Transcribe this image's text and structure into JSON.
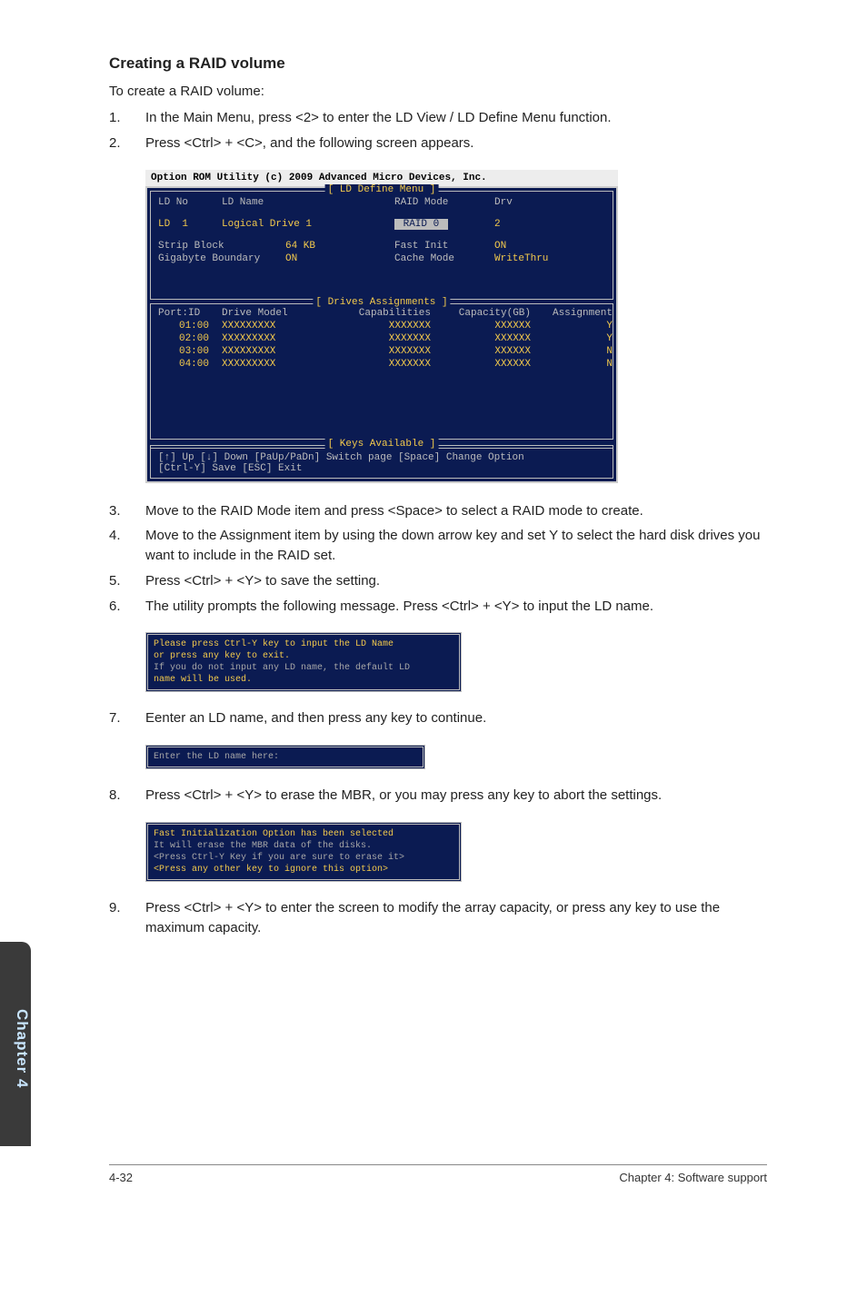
{
  "title": "Creating a RAID volume",
  "intro": "To create a RAID volume:",
  "steps1": [
    {
      "n": "1.",
      "t": "In the Main Menu, press <2> to enter the LD View / LD Define Menu function."
    },
    {
      "n": "2.",
      "t": "Press <Ctrl> + <C>, and the following screen appears."
    }
  ],
  "rom": {
    "header": "Option ROM Utility (c) 2009 Advanced Micro Devices, Inc.",
    "sec1": "[ LD Define Menu ]",
    "ld": {
      "noLbl": "LD No",
      "nameLbl": "LD Name",
      "modeLbl": "RAID Mode",
      "drvLbl": "Drv",
      "noVal": "LD  1",
      "nameVal": "Logical Drive 1",
      "modeVal": " RAID 0 ",
      "drvVal": "2",
      "sbLbl": "Strip Block",
      "sbVal": "64 KB",
      "fiLbl": "Fast Init",
      "fiVal": "ON",
      "gbLbl": "Gigabyte Boundary",
      "gbVal": "ON",
      "cmLbl": "Cache Mode",
      "cmVal": "WriteThru"
    },
    "sec2": "[ Drives Assignments ]",
    "hdr": {
      "a": "Port:ID",
      "b": "Drive Model",
      "c": "Capabilities",
      "d": "Capacity(GB)",
      "e": "Assignment"
    },
    "rows": [
      {
        "a": "01:00",
        "b": "XXXXXXXXX",
        "c": "XXXXXXX",
        "d": "XXXXXX",
        "e": "Y"
      },
      {
        "a": "02:00",
        "b": "XXXXXXXXX",
        "c": "XXXXXXX",
        "d": "XXXXXX",
        "e": "Y"
      },
      {
        "a": "03:00",
        "b": "XXXXXXXXX",
        "c": "XXXXXXX",
        "d": "XXXXXX",
        "e": "N"
      },
      {
        "a": "04:00",
        "b": "XXXXXXXXX",
        "c": "XXXXXXX",
        "d": "XXXXXX",
        "e": "N"
      }
    ],
    "sec3": "[ Keys Available ]",
    "foot1": "[↑] Up  [↓] Down  [PaUp/PaDn] Switch page  [Space] Change Option",
    "foot2": "[Ctrl-Y] Save  [ESC] Exit"
  },
  "steps2": [
    {
      "n": "3.",
      "t": "Move to the RAID Mode item and press <Space> to select a RAID mode to create."
    },
    {
      "n": "4.",
      "t": "Move to the Assignment item by using the down arrow key and set Y to select the hard disk drives you want to include in the RAID set."
    },
    {
      "n": "5.",
      "t": "Press <Ctrl> + <Y> to save the setting."
    },
    {
      "n": "6.",
      "t": "The utility prompts the following message. Press <Ctrl> + <Y> to input the LD name."
    }
  ],
  "box1": {
    "l1": "Please press Ctrl-Y key to input the LD Name",
    "l2": "or press any key to exit.",
    "l3": "If you do not input any LD name, the default LD",
    "l4": "name will be used."
  },
  "steps3": [
    {
      "n": "7.",
      "t": "Eenter an LD name, and then press any key to continue."
    }
  ],
  "box2": {
    "l1": "Enter the LD name here:"
  },
  "steps4": [
    {
      "n": "8.",
      "t": "Press <Ctrl> + <Y> to erase the MBR, or you may press any key to abort the settings."
    }
  ],
  "box3": {
    "l1": "Fast Initialization Option has been selected",
    "l2": "It will erase the MBR data of the disks.",
    "l3": "<Press Ctrl-Y Key if you are sure to erase it>",
    "l4": "<Press any other key to ignore this option>"
  },
  "steps5": [
    {
      "n": "9.",
      "t": "Press <Ctrl> + <Y> to enter the screen to modify the array capacity, or press any key to use the maximum capacity."
    }
  ],
  "sideTab": "Chapter 4",
  "footer": {
    "left": "4-32",
    "right": "Chapter 4: Software support"
  }
}
